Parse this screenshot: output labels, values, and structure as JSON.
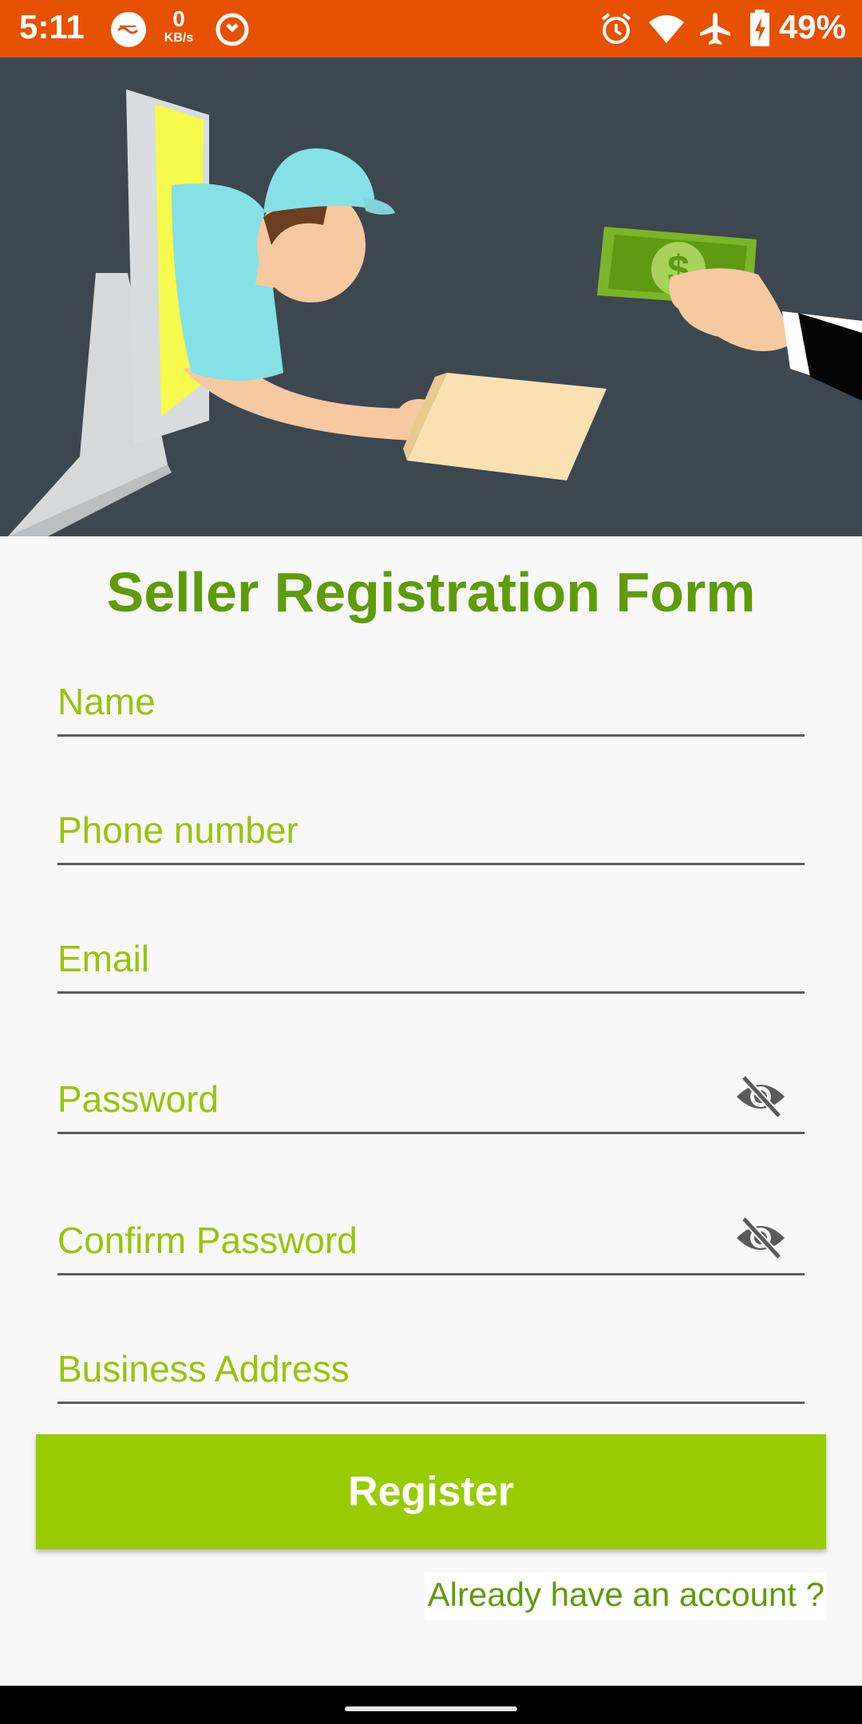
{
  "status_bar": {
    "time": "5:11",
    "net_speed_value": "0",
    "net_speed_unit": "KB/s",
    "battery": "49%",
    "icons": [
      "app-notification-icon",
      "no-disturb-icon",
      "alarm-icon",
      "wifi-icon",
      "airplane-icon",
      "battery-charging-icon"
    ]
  },
  "hero": {
    "icon": "delivery-illustration"
  },
  "form": {
    "title": "Seller Registration Form",
    "fields": {
      "name": {
        "placeholder": "Name"
      },
      "phone": {
        "placeholder": "Phone number"
      },
      "email": {
        "placeholder": "Email"
      },
      "password": {
        "placeholder": "Password",
        "toggle_icon": "visibility-off-icon"
      },
      "confirm_password": {
        "placeholder": "Confirm Password",
        "toggle_icon": "visibility-off-icon"
      },
      "business_address": {
        "placeholder": "Business Address"
      }
    },
    "register_label": "Register",
    "login_link": "Already have an account ?"
  },
  "colors": {
    "status_bar": "#e65100",
    "hero_background": "#3d4750",
    "title": "#5f9b0a",
    "field_label": "#99c30c",
    "button": "#99cc00"
  }
}
